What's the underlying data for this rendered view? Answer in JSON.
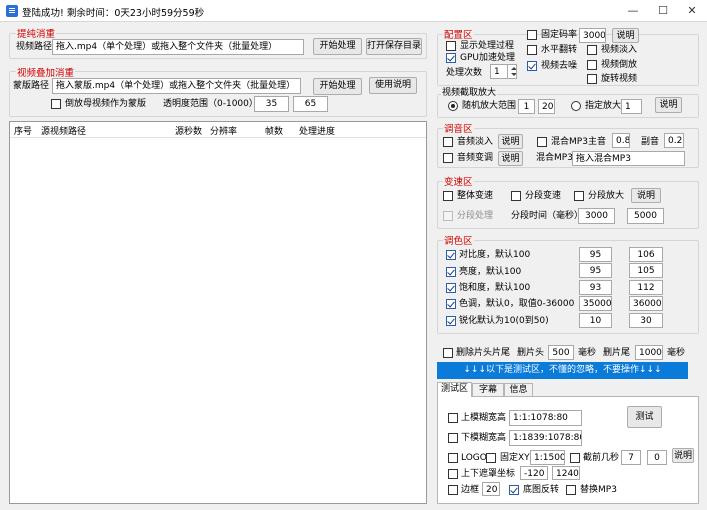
{
  "window": {
    "title": "登陆成功! 剩余时间：0天23小时59分59秒",
    "minimize": "—",
    "maximize": "☐",
    "close": "✕"
  },
  "extract": {
    "group": "提纯消重",
    "path_label": "视频路径",
    "path_value": "拖入.mp4（单个处理）或拖入整个文件夹（批量处理）",
    "start": "开始处理",
    "open_folder": "打开保存目录"
  },
  "overlay": {
    "group": "视频叠加消重",
    "mask_label": "蒙版路径",
    "mask_value": "拖入蒙版.mp4（单个处理）或拖入整个文件夹（批量处理）",
    "start": "开始处理",
    "help": "使用说明",
    "reverse_mask": "倒放母视频作为蒙版",
    "opacity_label": "透明度范围（0-1000）",
    "opacity_min": "35",
    "opacity_max": "65"
  },
  "table": {
    "columns": [
      "序号",
      "源视频路径",
      "源秒数",
      "分辨率",
      "帧数",
      "处理进度"
    ]
  },
  "config": {
    "group": "配置区",
    "show_process": "显示处理过程",
    "gpu_accel": "GPU加速处理",
    "process_times_label": "处理次数",
    "process_times_value": "1",
    "fixed_bitrate": "固定码率",
    "bitrate_value": "3000k",
    "help": "说明",
    "h_flip": "水平翻转",
    "denoise": "视频去噪",
    "fade_in": "视频淡入",
    "reverse": "视频倒放",
    "rotate": "旋转视频"
  },
  "crop": {
    "group": "视频截取放大",
    "random_label": "随机放大范围",
    "random_min": "1",
    "random_max": "20",
    "fixed_label": "指定放大",
    "fixed_value": "1",
    "help": "说明"
  },
  "audio": {
    "group": "调音区",
    "fade_in": "音频淡入",
    "help1": "说明",
    "mix_mp3": "混合MP3",
    "main_label": "主音",
    "main_value": "0.8",
    "sub_label": "副音",
    "sub_value": "0.2",
    "pitch": "音频变调",
    "help2": "说明",
    "mix_label": "混合MP3",
    "mix_value": "拖入混合MP3"
  },
  "speed": {
    "group": "变速区",
    "overall": "整体变速",
    "segment": "分段变速",
    "segment_zoom": "分段放大",
    "help": "说明",
    "segment_process": "分段处理",
    "segment_time_label": "分段时间（毫秒）",
    "segment_min": "3000",
    "segment_max": "5000"
  },
  "color": {
    "group": "调色区",
    "rows": [
      {
        "label": "对比度，默认100",
        "min": "95",
        "max": "106"
      },
      {
        "label": "亮度，默认100",
        "min": "95",
        "max": "105"
      },
      {
        "label": "饱和度，默认100",
        "min": "93",
        "max": "112"
      },
      {
        "label": "色调，默认0，取值0-36000",
        "min": "35000",
        "max": "36000"
      },
      {
        "label": "锐化默认为10(0到50)",
        "min": "10",
        "max": "30"
      }
    ]
  },
  "trim": {
    "delete_label": "删除片头片尾",
    "head_label": "删片头",
    "head_value": "500",
    "head_unit": "毫秒",
    "tail_label": "删片尾",
    "tail_value": "1000",
    "tail_unit": "毫秒"
  },
  "notice": "↓↓↓以下是测试区，不懂的忽略，不要操作↓↓↓",
  "tabs": [
    "测试区",
    "字幕",
    "信息"
  ],
  "test": {
    "upper_blur": "上模糊宽高",
    "upper_value": "1:1:1078:80",
    "lower_blur": "下模糊宽高",
    "lower_value": "1:1839:1078:80",
    "test_button": "测试",
    "logo": "LOGO",
    "fixed_xy": "固定XY",
    "xy_value": "1:1500",
    "cut_front": "截前几秒",
    "cut_a": "7",
    "cut_b": "0",
    "help": "说明",
    "cover_label": "上下遮罩坐标",
    "cover_a": "-120",
    "cover_b": "1240",
    "border_label": "边框",
    "border_value": "20",
    "edge_invert": "底图反转",
    "replace_mp3": "替换MP3"
  }
}
